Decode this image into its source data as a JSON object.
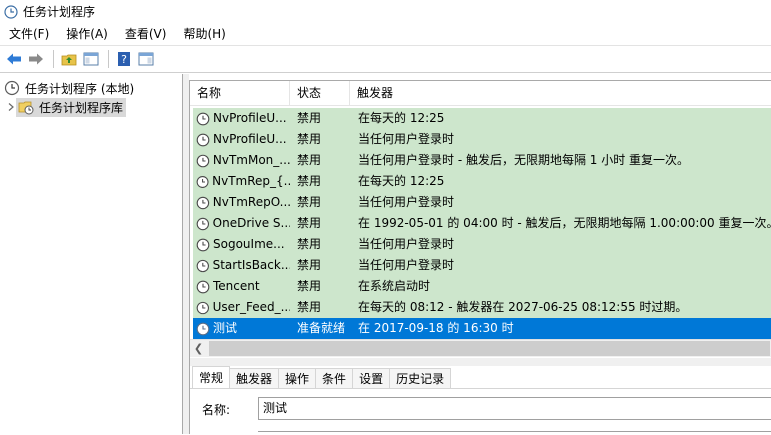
{
  "window": {
    "title": "任务计划程序"
  },
  "menu": [
    "文件(F)",
    "操作(A)",
    "查看(V)",
    "帮助(H)"
  ],
  "tree": {
    "root": "任务计划程序 (本地)",
    "child": "任务计划程序库"
  },
  "list": {
    "columns": [
      "名称",
      "状态",
      "触发器"
    ],
    "rows": [
      {
        "name": "NvProfileU...",
        "status": "禁用",
        "trigger": "在每天的 12:25"
      },
      {
        "name": "NvProfileU...",
        "status": "禁用",
        "trigger": "当任何用户登录时"
      },
      {
        "name": "NvTmMon_...",
        "status": "禁用",
        "trigger": "当任何用户登录时 - 触发后，无限期地每隔 1 小时 重复一次。"
      },
      {
        "name": "NvTmRep_{...",
        "status": "禁用",
        "trigger": "在每天的 12:25"
      },
      {
        "name": "NvTmRepO...",
        "status": "禁用",
        "trigger": "当任何用户登录时"
      },
      {
        "name": "OneDrive S...",
        "status": "禁用",
        "trigger": "在 1992-05-01 的 04:00 时 - 触发后，无限期地每隔 1.00:00:00 重复一次。"
      },
      {
        "name": "SogouIme...",
        "status": "禁用",
        "trigger": "当任何用户登录时"
      },
      {
        "name": "StartIsBack...",
        "status": "禁用",
        "trigger": "当任何用户登录时"
      },
      {
        "name": "Tencent",
        "status": "禁用",
        "trigger": "在系统启动时"
      },
      {
        "name": "User_Feed_...",
        "status": "禁用",
        "trigger": "在每天的 08:12 - 触发器在 2027-06-25 08:12:55 时过期。"
      },
      {
        "name": "测试",
        "status": "准备就绪",
        "trigger": "在 2017-09-18 的 16:30 时"
      }
    ]
  },
  "tabs": [
    "常规",
    "触发器",
    "操作",
    "条件",
    "设置",
    "历史记录"
  ],
  "detail": {
    "name_label": "名称:",
    "name_value": "测试"
  },
  "colors": {
    "row_bg": "#cde6cc",
    "selected_bg": "#0078d7"
  }
}
